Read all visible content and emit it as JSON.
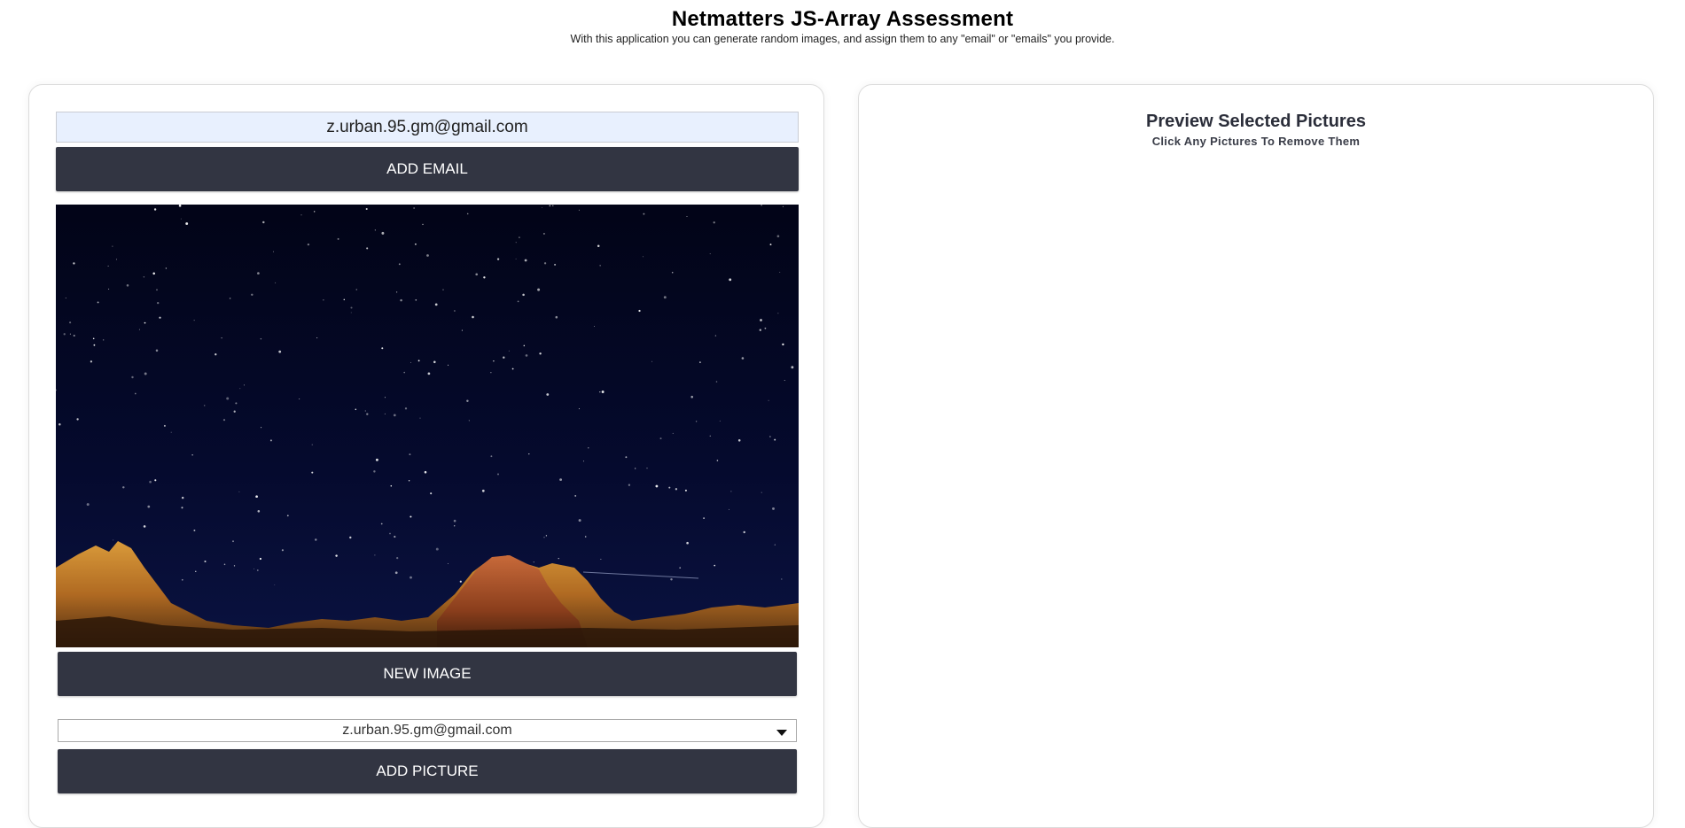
{
  "header": {
    "title": "Netmatters JS-Array Assessment",
    "subtitle": "With this application you can generate random images, and assign them to any \"email\" or \"emails\" you provide."
  },
  "left_panel": {
    "email_input_value": "z.urban.95.gm@gmail.com",
    "add_email_label": "ADD EMAIL",
    "image": {
      "description_icon": "starry-night-mountains-image"
    },
    "new_image_label": "NEW IMAGE",
    "email_select_value": "z.urban.95.gm@gmail.com",
    "add_picture_label": "ADD PICTURE"
  },
  "right_panel": {
    "title": "Preview Selected Pictures",
    "subtitle": "Click Any Pictures To Remove Them"
  },
  "colors": {
    "button_bg": "#323542",
    "input_bg": "#e8f0fe",
    "sky": "#03061f"
  }
}
